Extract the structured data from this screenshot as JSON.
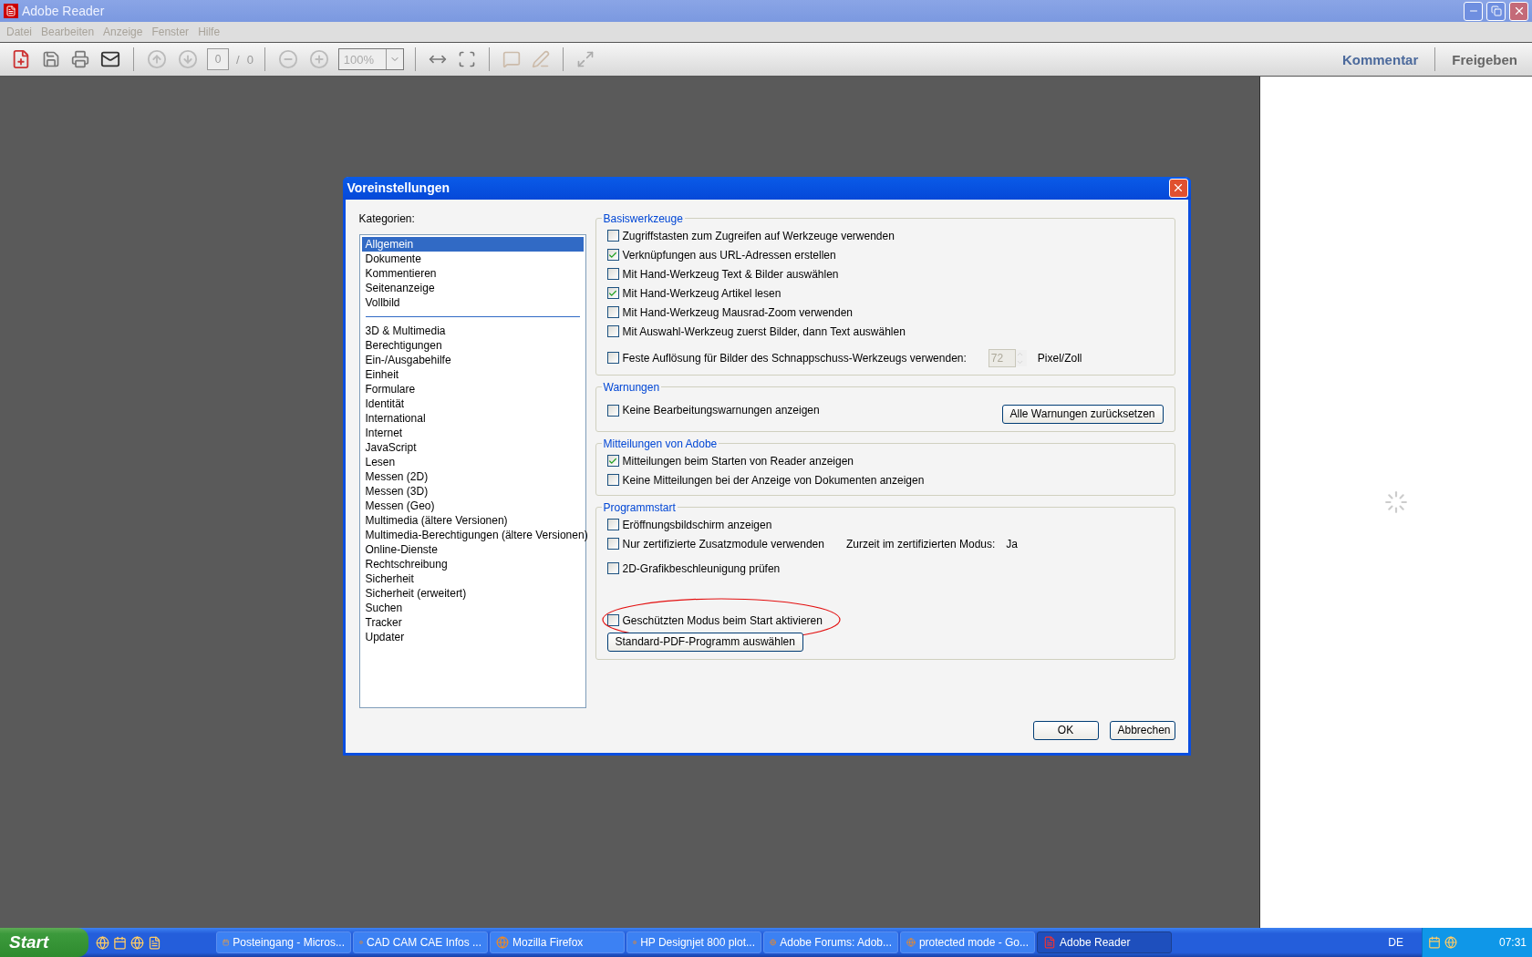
{
  "window": {
    "title": "Adobe Reader"
  },
  "menu": [
    {
      "label": "Datei",
      "disabled": true
    },
    {
      "label": "Bearbeiten",
      "disabled": true
    },
    {
      "label": "Anzeige",
      "disabled": true
    },
    {
      "label": "Fenster",
      "disabled": true
    },
    {
      "label": "Hilfe",
      "disabled": true
    }
  ],
  "toolbar": {
    "page_value": "0",
    "page_separator": "/",
    "page_total": "0",
    "zoom_value": "100%",
    "right_buttons": [
      "Kommentar",
      "Freigeben"
    ]
  },
  "dialog": {
    "title": "Voreinstellungen",
    "categories_label": "Kategorien:",
    "categories_primary": [
      {
        "label": "Allgemein",
        "selected": true
      },
      {
        "label": "Dokumente",
        "selected": false
      },
      {
        "label": "Kommentieren",
        "selected": false
      },
      {
        "label": "Seitenanzeige",
        "selected": false
      },
      {
        "label": "Vollbild",
        "selected": false
      }
    ],
    "categories_secondary": [
      {
        "label": "3D & Multimedia",
        "selected": false
      },
      {
        "label": "Berechtigungen",
        "selected": false
      },
      {
        "label": "Ein-/Ausgabehilfe",
        "selected": false
      },
      {
        "label": "Einheit",
        "selected": false
      },
      {
        "label": "Formulare",
        "selected": false
      },
      {
        "label": "Identität",
        "selected": false
      },
      {
        "label": "International",
        "selected": false
      },
      {
        "label": "Internet",
        "selected": false
      },
      {
        "label": "JavaScript",
        "selected": false
      },
      {
        "label": "Lesen",
        "selected": false
      },
      {
        "label": "Messen (2D)",
        "selected": false
      },
      {
        "label": "Messen (3D)",
        "selected": false
      },
      {
        "label": "Messen (Geo)",
        "selected": false
      },
      {
        "label": "Multimedia (ältere Versionen)",
        "selected": false
      },
      {
        "label": "Multimedia-Berechtigungen (ältere Versionen)",
        "selected": false
      },
      {
        "label": "Online-Dienste",
        "selected": false
      },
      {
        "label": "Rechtschreibung",
        "selected": false
      },
      {
        "label": "Sicherheit",
        "selected": false
      },
      {
        "label": "Sicherheit (erweitert)",
        "selected": false
      },
      {
        "label": "Suchen",
        "selected": false
      },
      {
        "label": "Tracker",
        "selected": false
      },
      {
        "label": "Updater",
        "selected": false
      }
    ],
    "groups": [
      {
        "title": "Basiswerkzeuge",
        "options": [
          {
            "kind": "checkbox",
            "label": "Zugriffstasten zum Zugreifen auf Werkzeuge verwenden",
            "checked": false,
            "highlighted": false
          },
          {
            "kind": "checkbox",
            "label": "Verknüpfungen aus URL-Adressen erstellen",
            "checked": true,
            "highlighted": false
          },
          {
            "kind": "checkbox",
            "label": "Mit Hand-Werkzeug Text & Bilder auswählen",
            "checked": false,
            "highlighted": false
          },
          {
            "kind": "checkbox",
            "label": "Mit Hand-Werkzeug Artikel lesen",
            "checked": true,
            "highlighted": false
          },
          {
            "kind": "checkbox",
            "label": "Mit Hand-Werkzeug Mausrad-Zoom verwenden",
            "checked": false,
            "highlighted": false
          },
          {
            "kind": "checkbox",
            "label": "Mit Auswahl-Werkzeug zuerst Bilder, dann Text auswählen",
            "checked": false,
            "highlighted": false
          },
          {
            "kind": "spin",
            "label": "Feste Auflösung für Bilder des Schnappschuss-Werkzeugs verwenden:",
            "checked": false,
            "highlighted": false,
            "value": "72",
            "unit": "Pixel/Zoll"
          }
        ]
      },
      {
        "title": "Warnungen",
        "options": [
          {
            "kind": "button",
            "label": "Keine Bearbeitungswarnungen anzeigen",
            "checked": false,
            "highlighted": false,
            "button": "Alle Warnungen zurücksetzen"
          }
        ]
      },
      {
        "title": "Mitteilungen von Adobe",
        "options": [
          {
            "kind": "checkbox",
            "label": "Mitteilungen beim Starten von Reader anzeigen",
            "checked": true,
            "highlighted": false
          },
          {
            "kind": "checkbox",
            "label": "Keine Mitteilungen bei der Anzeige von Dokumenten anzeigen",
            "checked": false,
            "highlighted": false
          }
        ]
      },
      {
        "title": "Programmstart",
        "options": [
          {
            "kind": "checkbox",
            "label": "Eröffnungsbildschirm anzeigen",
            "checked": false,
            "highlighted": false
          },
          {
            "kind": "status",
            "label": "Nur zertifizierte Zusatzmodule verwenden",
            "checked": false,
            "highlighted": false,
            "status_label": "Zurzeit im zertifizierten Modus:",
            "status_value": "Ja"
          },
          {
            "kind": "checkbox",
            "label": "2D-Grafikbeschleunigung prüfen",
            "checked": false,
            "highlighted": false
          },
          {
            "kind": "checkbox",
            "label": "Geschützten Modus beim Start aktivieren",
            "checked": false,
            "highlighted": true
          }
        ],
        "button": "Standard-PDF-Programm auswählen"
      }
    ],
    "buttons": [
      "OK",
      "Abbrechen"
    ]
  },
  "taskbar": {
    "start": "Start",
    "tasks": [
      {
        "label": "Posteingang - Micros...",
        "kind": "mail",
        "selected": false
      },
      {
        "label": "CAD CAM CAE Infos ...",
        "kind": "browser",
        "selected": false
      },
      {
        "label": "Mozilla Firefox",
        "kind": "browser",
        "selected": false
      },
      {
        "label": "HP Designjet 800 plot...",
        "kind": "browser",
        "selected": false
      },
      {
        "label": "Adobe Forums: Adob...",
        "kind": "browser",
        "selected": false
      },
      {
        "label": "protected mode - Go...",
        "kind": "browser",
        "selected": false
      },
      {
        "label": "Adobe Reader",
        "kind": "pdf",
        "selected": true
      }
    ],
    "language": "DE",
    "clock": "07:31"
  }
}
